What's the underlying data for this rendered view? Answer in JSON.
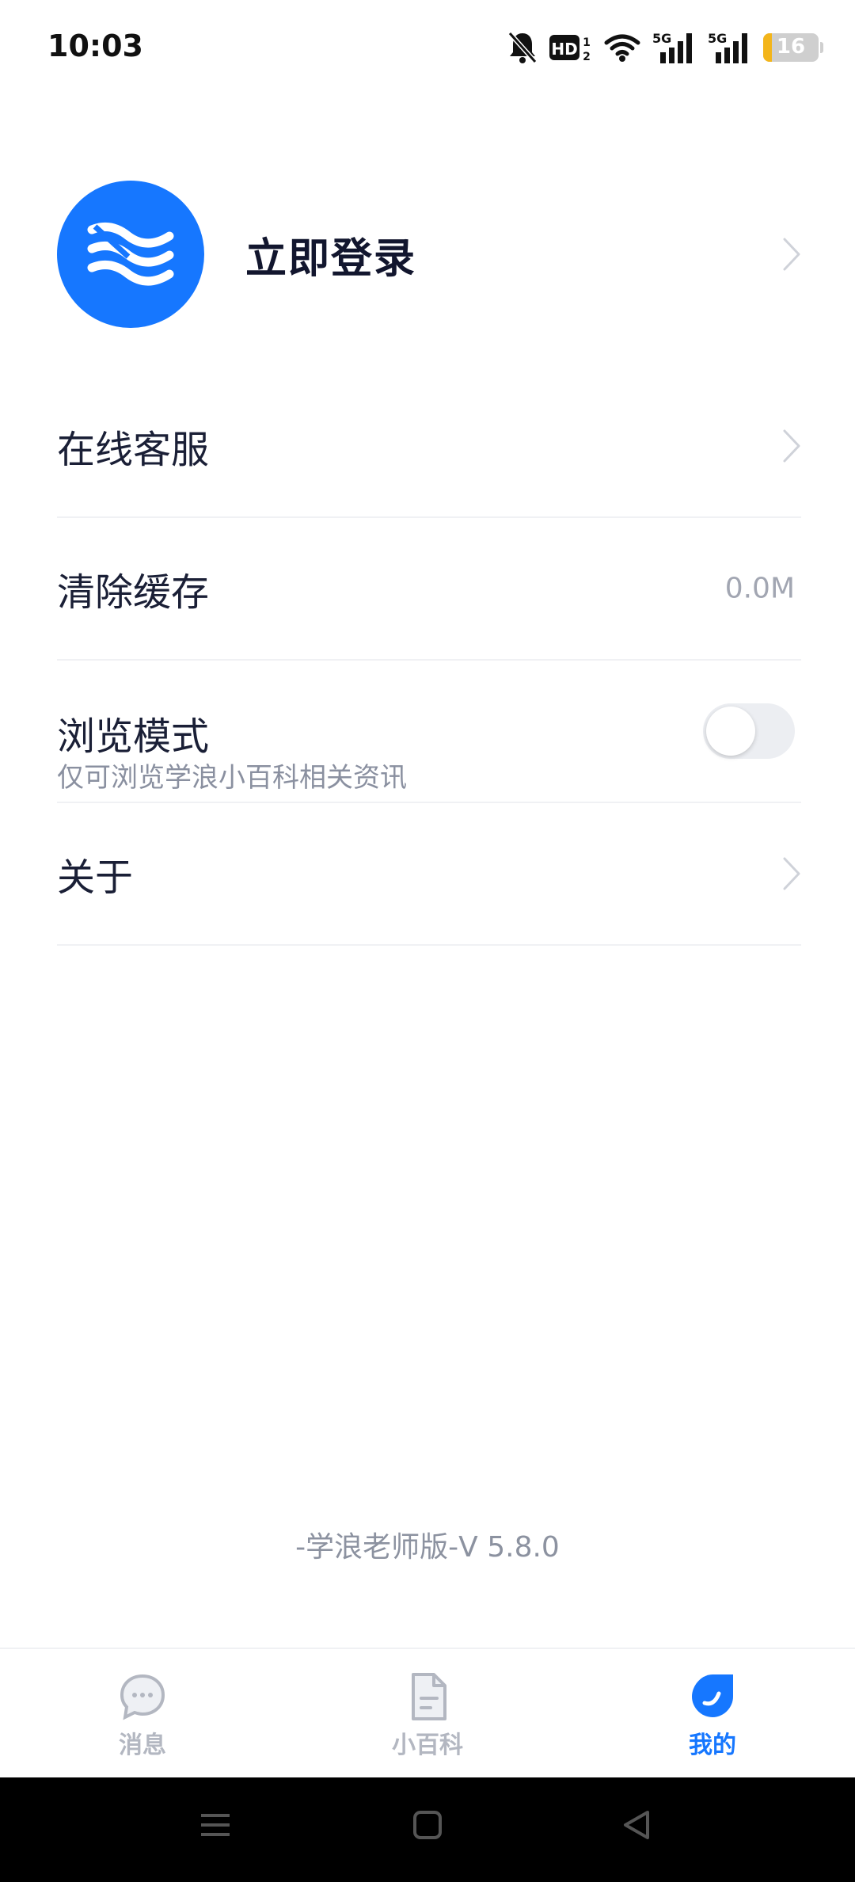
{
  "status_bar": {
    "time": "10:03",
    "icons": [
      "bell-muted-icon",
      "hd-icon",
      "wifi-icon",
      "signal-5g-icon",
      "signal-5g-icon",
      "battery-icon"
    ],
    "hd_label": "HD",
    "network_label": "5G",
    "battery": {
      "level": "16",
      "fraction": 0.16,
      "color": "#f3b51a"
    }
  },
  "profile": {
    "login_label": "立即登录",
    "avatar_color": "#1677ff"
  },
  "menu": {
    "customer_service": "在线客服",
    "clear_cache": {
      "label": "清除缓存",
      "value": "0.0M"
    },
    "browse_mode": {
      "label": "浏览模式",
      "sublabel": "仅可浏览学浪小百科相关资讯",
      "enabled": false
    },
    "about": "关于"
  },
  "version": "-学浪老师版-V 5.8.0",
  "tabbar": {
    "tabs": [
      {
        "label": "消息",
        "icon": "message-icon",
        "active": false
      },
      {
        "label": "小百科",
        "icon": "document-icon",
        "active": false
      },
      {
        "label": "我的",
        "icon": "profile-icon",
        "active": true
      }
    ],
    "active_color": "#1677ff",
    "inactive_color": "#b3b7c1"
  },
  "navbar": {
    "buttons": [
      "menu-icon",
      "home-icon",
      "back-icon"
    ]
  }
}
